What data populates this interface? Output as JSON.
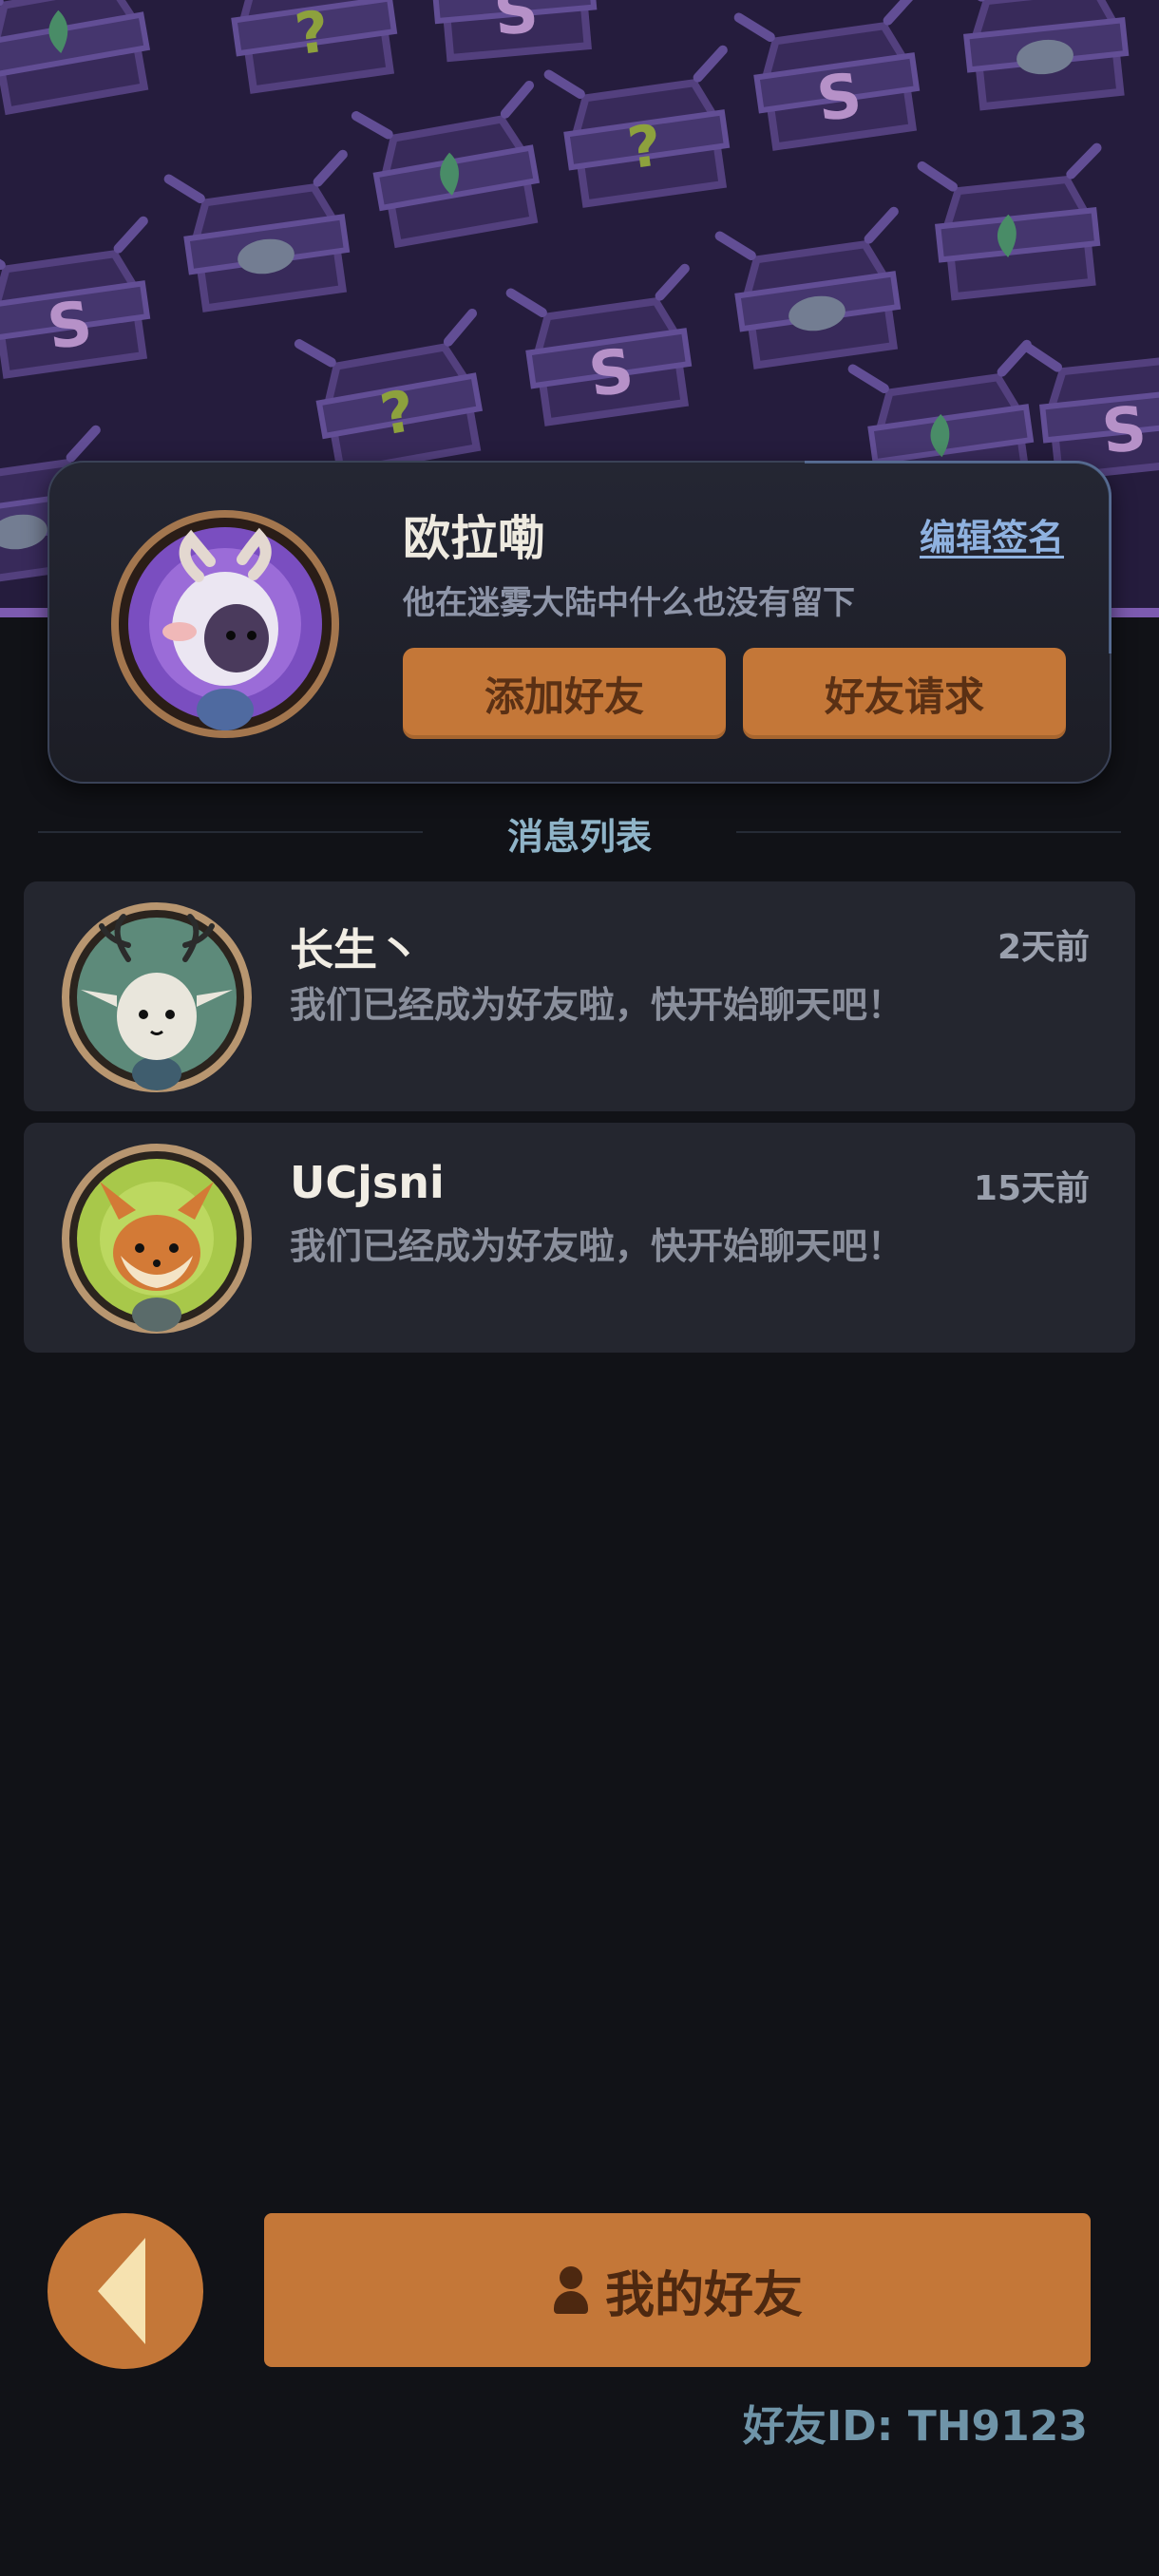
{
  "colors": {
    "background": "#111217",
    "banner": "#251c3d",
    "accent_orange": "#c47738",
    "button_text": "#5a3014",
    "link_blue": "#8fb2e0",
    "card": "#24262f"
  },
  "profile": {
    "name": "欧拉嘞",
    "edit_signature_label": "编辑签名",
    "signature": "他在迷雾大陆中什么也没有留下",
    "add_friend_label": "添加好友",
    "friend_requests_label": "好友请求",
    "avatar_icon": "sheep-avatar"
  },
  "section": {
    "title": "消息列表"
  },
  "messages": [
    {
      "name": "长生丶",
      "time": "2天前",
      "text": "我们已经成为好友啦，快开始聊天吧！",
      "avatar_icon": "antlered-creature-avatar"
    },
    {
      "name": "UCjsni",
      "time": "15天前",
      "text": "我们已经成为好友啦，快开始聊天吧！",
      "avatar_icon": "fox-avatar"
    }
  ],
  "footer": {
    "back_icon": "back-arrow-icon",
    "my_friends_label": "我的好友",
    "friend_id": "好友ID: TH9123"
  }
}
